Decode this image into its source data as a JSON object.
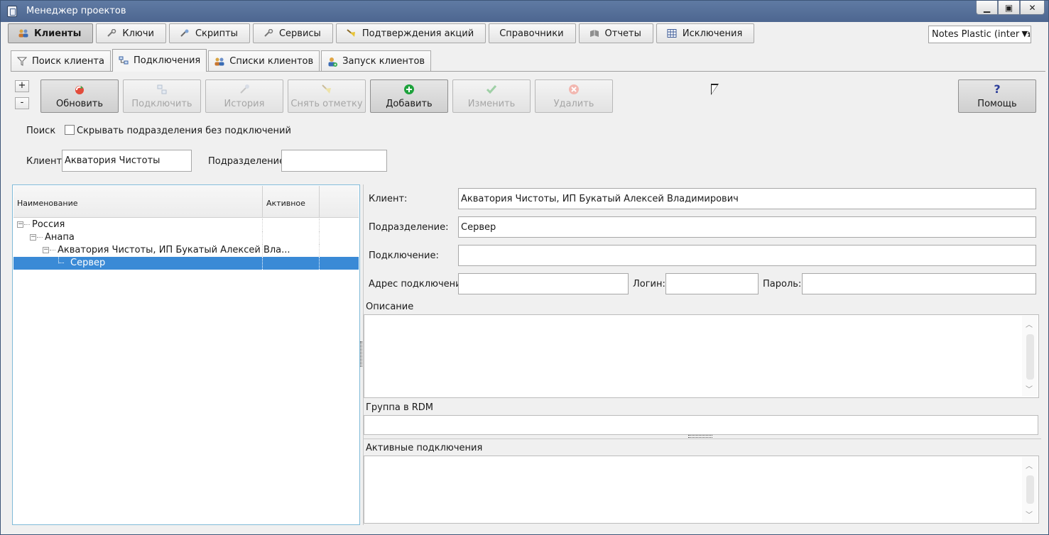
{
  "window": {
    "title": "Менеджер проектов",
    "controls": {
      "minimize": "▁",
      "maximize": "▣",
      "close": "✕"
    }
  },
  "main_tabs": [
    {
      "label": "Клиенты",
      "icon": "users-icon",
      "active": true
    },
    {
      "label": "Ключи",
      "icon": "wrench-icon"
    },
    {
      "label": "Скрипты",
      "icon": "tools-icon"
    },
    {
      "label": "Сервисы",
      "icon": "wrench-icon"
    },
    {
      "label": "Подтверждения акций",
      "icon": "broom-icon"
    },
    {
      "label": "Справочники",
      "icon": ""
    },
    {
      "label": "Отчеты",
      "icon": "book-icon"
    },
    {
      "label": "Исключения",
      "icon": "grid-icon"
    }
  ],
  "org_select": {
    "value": "Notes Plastic (interna"
  },
  "sub_tabs": [
    {
      "label": "Поиск клиента",
      "icon": "filter-icon"
    },
    {
      "label": "Подключения",
      "icon": "network-icon",
      "active": true
    },
    {
      "label": "Списки клиентов",
      "icon": "users-icon"
    },
    {
      "label": "Запуск клиентов",
      "icon": "user-add-icon"
    }
  ],
  "expand": {
    "plus": "+",
    "minus": "-"
  },
  "toolbar": {
    "refresh": "Обновить",
    "connect": "Подключить",
    "history": "История",
    "unmark": "Снять отметку",
    "add": "Добавить",
    "edit": "Изменить",
    "delete": "Удалить",
    "help": "Помощь",
    "help_glyph": "?"
  },
  "search": {
    "label": "Поиск",
    "hide_checkbox_label": "Скрывать подразделения без подключений",
    "hide_checked": false,
    "client_label": "Клиент:",
    "client_value": "Акватория Чистоты",
    "division_label": "Подразделение:",
    "division_value": ""
  },
  "tree": {
    "columns": [
      "Наименование",
      "Активное"
    ],
    "rows": [
      {
        "text": "Россия",
        "level": 0,
        "expander": "−"
      },
      {
        "text": "Анапа",
        "level": 1,
        "expander": "−"
      },
      {
        "text": "Акватория Чистоты, ИП Букатый Алексей Вла...",
        "level": 2,
        "expander": "−"
      },
      {
        "text": "Сервер",
        "level": 3,
        "selected": true
      }
    ]
  },
  "details": {
    "client_label": "Клиент:",
    "client_value": "Акватория Чистоты, ИП Букатый Алексей Владимирович",
    "division_label": "Подразделение:",
    "division_value": "Сервер",
    "connection_label": "Подключение:",
    "connection_value": "",
    "address_label": "Адрес подключения",
    "address_value": "",
    "login_label": "Логин:",
    "login_value": "",
    "password_label": "Пароль:",
    "password_value": "",
    "description_label": "Описание",
    "rdm_group_label": "Группа в RDM",
    "active_connections_label": "Активные подключения"
  },
  "colors": {
    "titlebar": "#5f7aa3",
    "selection": "#3a8ad6",
    "add_icon": "#1ea23c"
  }
}
